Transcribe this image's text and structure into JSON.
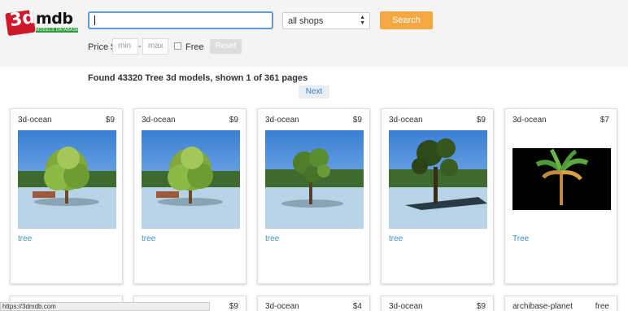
{
  "header": {
    "logo": {
      "main": "3d",
      "suffix": "mdb",
      "tagline": "MODELS DATABASE",
      "brand_color": "#d0182c"
    },
    "search": {
      "value": "",
      "placeholder": ""
    },
    "shop_select": {
      "selected": "all shops"
    },
    "search_button": "Search"
  },
  "filters": {
    "price_label": "Price $",
    "min_placeholder": "min",
    "max_placeholder": "max",
    "separator": "-",
    "free_label": "Free",
    "free_checked": false,
    "reset_label": "Reset"
  },
  "results": {
    "prefix": "Found 43320 ",
    "term": "Tree",
    "suffix": " 3d models, shown 1 of 361 pages"
  },
  "pagination": {
    "next_label": "Next"
  },
  "cards": [
    {
      "shop": "3d-ocean",
      "price": "$9",
      "title": "tree",
      "thumb": "bushy-tree"
    },
    {
      "shop": "3d-ocean",
      "price": "$9",
      "title": "tree",
      "thumb": "bushy-tree"
    },
    {
      "shop": "3d-ocean",
      "price": "$9",
      "title": "tree",
      "thumb": "sparse-tree"
    },
    {
      "shop": "3d-ocean",
      "price": "$9",
      "title": "tree",
      "thumb": "dark-tree"
    },
    {
      "shop": "3d-ocean",
      "price": "$7",
      "title": "Tree",
      "thumb": "palm-tree"
    }
  ],
  "cards_row2": [
    {
      "shop": "",
      "price": ""
    },
    {
      "shop": "",
      "price": "$9"
    },
    {
      "shop": "3d-ocean",
      "price": "$4"
    },
    {
      "shop": "3d-ocean",
      "price": "$9"
    },
    {
      "shop": "archibase-planet",
      "price": "free"
    }
  ],
  "status_url": "https://3dmdb.com",
  "colors": {
    "accent": "#f5a842",
    "link": "#3b8fd4",
    "focus": "#5b9dd9"
  }
}
